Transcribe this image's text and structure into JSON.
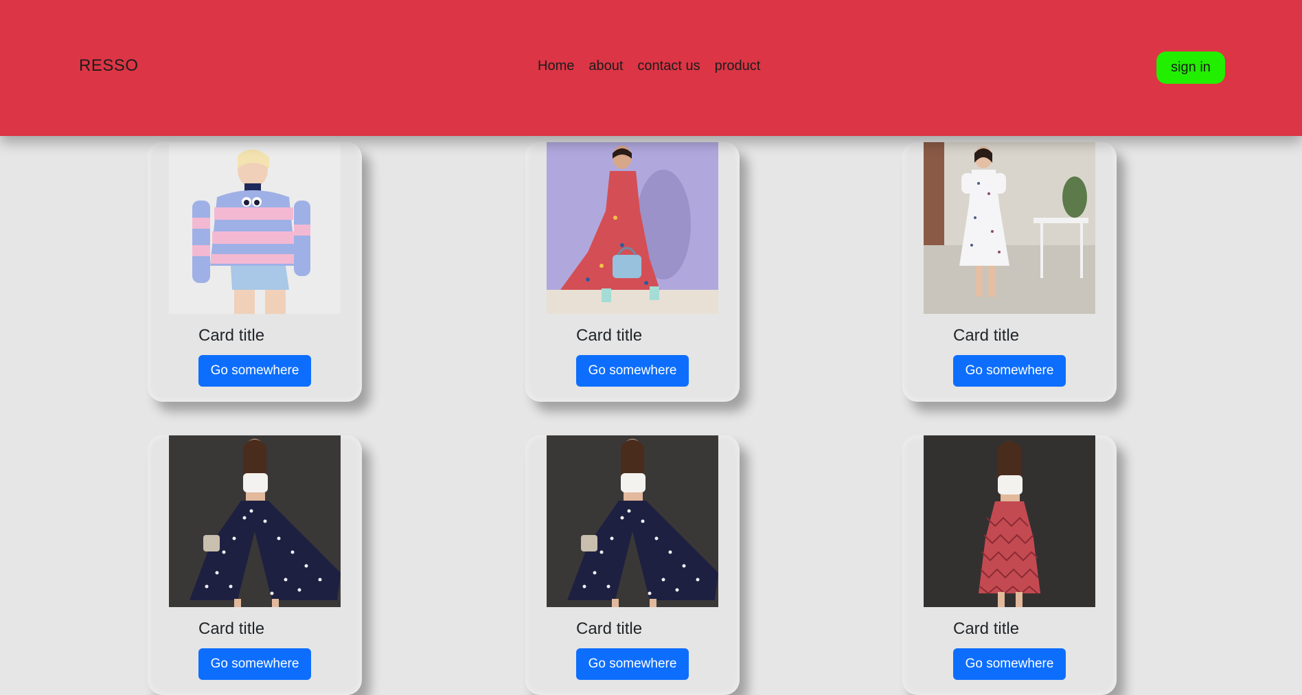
{
  "navbar": {
    "brand": "RESSO",
    "links": [
      "Home",
      "about",
      "contact us",
      "product"
    ],
    "signin_label": "sign in",
    "background": "#dc3545",
    "signin_color": "#22ee00"
  },
  "cards": [
    {
      "title": "Card title",
      "button": "Go somewhere",
      "image": "striped-sweater-outfit"
    },
    {
      "title": "Card title",
      "button": "Go somewhere",
      "image": "floral-maxi-dress"
    },
    {
      "title": "Card title",
      "button": "Go somewhere",
      "image": "white-floral-dress"
    },
    {
      "title": "Card title",
      "button": "Go somewhere",
      "image": "polka-dot-palazzo"
    },
    {
      "title": "Card title",
      "button": "Go somewhere",
      "image": "polka-dot-palazzo"
    },
    {
      "title": "Card title",
      "button": "Go somewhere",
      "image": "red-print-skirt"
    }
  ],
  "colors": {
    "page_background": "#e6e6e6",
    "button": "#0d6efd"
  }
}
